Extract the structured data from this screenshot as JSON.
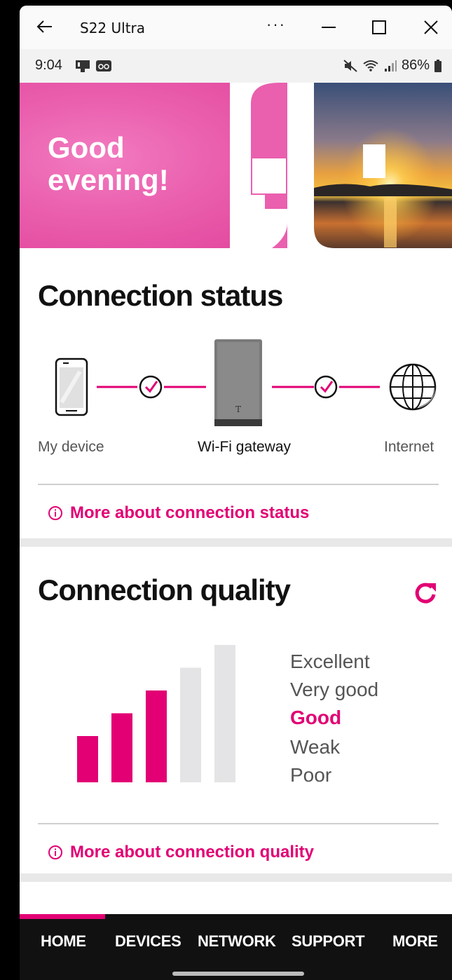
{
  "window": {
    "title": "S22 Ultra",
    "more_label": "···"
  },
  "statusbar": {
    "time": "9:04",
    "battery": "86%"
  },
  "hero": {
    "greeting_line1": "Good",
    "greeting_line2": "evening!"
  },
  "connection_status": {
    "title": "Connection status",
    "nodes": [
      {
        "label": "My device",
        "icon": "phone-icon"
      },
      {
        "label": "Wi-Fi gateway",
        "icon": "gateway-icon"
      },
      {
        "label": "Internet",
        "icon": "globe-icon"
      }
    ],
    "more_link": "More about connection status"
  },
  "connection_quality": {
    "title": "Connection quality",
    "levels": [
      "Excellent",
      "Very good",
      "Good",
      "Weak",
      "Poor"
    ],
    "current_level": "Good",
    "bars_filled": 3,
    "bars_total": 5,
    "more_link": "More about connection quality"
  },
  "bottom_nav": {
    "items": [
      "HOME",
      "DEVICES",
      "NETWORK",
      "SUPPORT",
      "MORE"
    ],
    "active": "HOME"
  },
  "colors": {
    "accent": "#e20074",
    "inactive_bar": "#e4e4e6",
    "nav_bg": "#111111"
  }
}
